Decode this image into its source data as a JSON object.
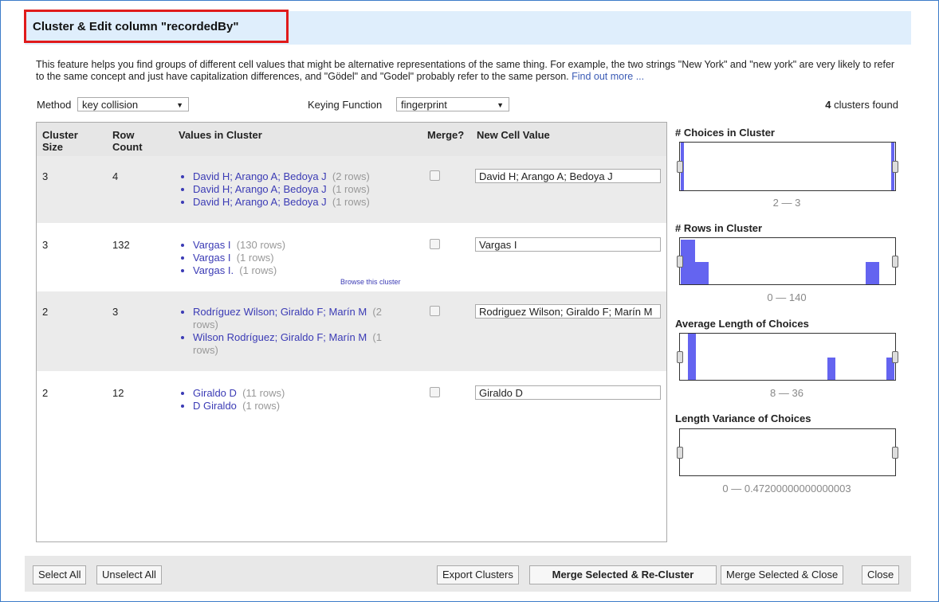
{
  "dialog": {
    "title": "Cluster & Edit column \"recordedBy\"",
    "description": "This feature helps you find groups of different cell values that might be alternative representations of the same thing. For example, the two strings \"New York\" and \"new york\" are very likely to refer to the same concept and just have capitalization differences, and \"Gödel\" and \"Godel\" probably refer to the same person.",
    "find_out_more": "Find out more ..."
  },
  "controls": {
    "method_label": "Method",
    "method_value": "key collision",
    "keying_label": "Keying Function",
    "keying_value": "fingerprint",
    "clusters_found_count": "4",
    "clusters_found_text": "clusters found"
  },
  "table": {
    "headers": {
      "cluster_size": "Cluster Size",
      "row_count": "Row Count",
      "values": "Values in Cluster",
      "merge": "Merge?",
      "new_value": "New Cell Value"
    },
    "rows": [
      {
        "cluster_size": "3",
        "row_count": "4",
        "values": [
          {
            "text": "David H; Arango A; Bedoya J",
            "count": "(2 rows)"
          },
          {
            "text": "David H; Arango A; Bedoya J",
            "count": "(1 rows)"
          },
          {
            "text": "David H; Arango A; Bedoya J",
            "count": "(1 rows)"
          }
        ],
        "new_value": "David H; Arango A; Bedoya J"
      },
      {
        "cluster_size": "3",
        "row_count": "132",
        "values": [
          {
            "text": "Vargas I",
            "count": "(130 rows)"
          },
          {
            "text": "Vargas I",
            "count": "(1 rows)"
          },
          {
            "text": "Vargas I.",
            "count": "(1 rows)"
          }
        ],
        "browse": "Browse this cluster",
        "new_value": "Vargas I"
      },
      {
        "cluster_size": "2",
        "row_count": "3",
        "values": [
          {
            "text": "Rodríguez Wilson; Giraldo F; Marín M",
            "count": "(2 rows)"
          },
          {
            "text": "Wilson Rodríguez; Giraldo F; Marín M",
            "count": "(1 rows)"
          }
        ],
        "new_value": "Rodriguez Wilson; Giraldo F; Marín M"
      },
      {
        "cluster_size": "2",
        "row_count": "12",
        "values": [
          {
            "text": "Giraldo D",
            "count": "(11 rows)"
          },
          {
            "text": "D Giraldo",
            "count": "(1 rows)"
          }
        ],
        "new_value": "Giraldo D"
      }
    ]
  },
  "facets": [
    {
      "title": "# Choices in Cluster",
      "range": "2 — 3"
    },
    {
      "title": "# Rows in Cluster",
      "range": "0 — 140"
    },
    {
      "title": "Average Length of Choices",
      "range": "8 — 36"
    },
    {
      "title": "Length Variance of Choices",
      "range": "0 — 0.47200000000000003"
    }
  ],
  "buttons": {
    "select_all": "Select All",
    "unselect_all": "Unselect All",
    "export": "Export Clusters",
    "merge_recluster": "Merge Selected & Re-Cluster",
    "merge_close": "Merge Selected & Close",
    "close": "Close"
  },
  "colors": {
    "title_border": "#e01b1b",
    "title_bg": "#dfeefc",
    "link": "#3b3bb5",
    "histogram_bar": "#6464f0"
  }
}
